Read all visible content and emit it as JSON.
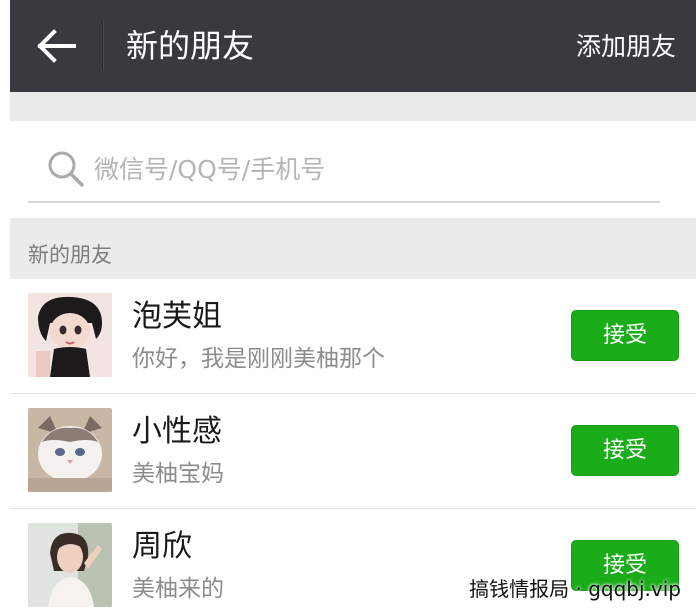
{
  "header": {
    "title": "新的朋友",
    "action_label": "添加朋友",
    "back_icon": "arrow-left-icon"
  },
  "search": {
    "placeholder": "微信号/QQ号/手机号",
    "value": "",
    "icon": "search-icon"
  },
  "section": {
    "label": "新的朋友"
  },
  "friends": [
    {
      "name": "泡芙姐",
      "message": "你好，我是刚刚美柚那个",
      "button_label": "接受",
      "avatar": "cartoon-girl-avatar"
    },
    {
      "name": "小性感",
      "message": "美柚宝妈",
      "button_label": "接受",
      "avatar": "cat-avatar"
    },
    {
      "name": "周欣",
      "message": "美柚来的",
      "button_label": "接受",
      "avatar": "woman-photo-avatar"
    }
  ],
  "watermark": {
    "text": "搞钱情报局 · gqqbj.vip"
  },
  "colors": {
    "topbar": "#393a3e",
    "background": "#ebebeb",
    "accent_green": "#1aad19"
  }
}
